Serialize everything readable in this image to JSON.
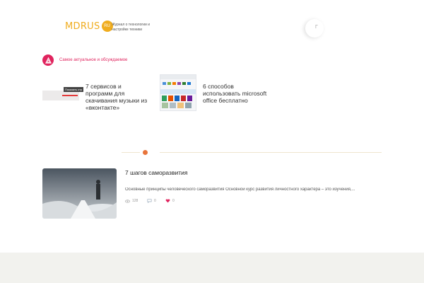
{
  "header": {
    "logo_text": "MDRUS",
    "logo_badge": "RU",
    "tagline": "Журнал о технологии и настройке техники",
    "search_glyph": "Г"
  },
  "trending": {
    "label": "Самое актуальное и обсуждаемое",
    "cards": [
      {
        "title": "7 сервисов и программ для скачивания музыки из «вконтакте»",
        "thumb_tag": "Показать стр"
      },
      {
        "title": "6 способов использовать microsoft office бесплатно"
      }
    ]
  },
  "article": {
    "title": "7 шагов саморазвития",
    "excerpt": "Основные принципы человеческого саморазвития Основной курс развития личностного характера – это изучения,...",
    "views": "128",
    "comments": "0",
    "likes": "0"
  },
  "colors": {
    "brand": "#f0ad1f",
    "accent": "#e0245e",
    "divider_dot": "#e8743b"
  }
}
